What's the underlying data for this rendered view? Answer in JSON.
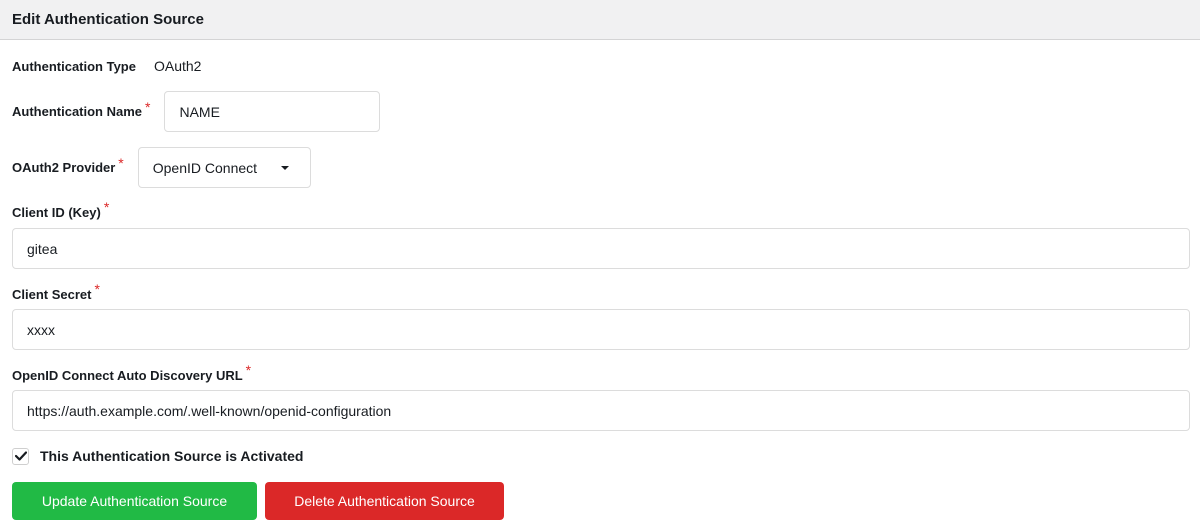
{
  "header": {
    "title": "Edit Authentication Source"
  },
  "form": {
    "auth_type": {
      "label": "Authentication Type",
      "value": "OAuth2"
    },
    "auth_name": {
      "label": "Authentication Name",
      "value": "NAME"
    },
    "provider": {
      "label": "OAuth2 Provider",
      "selected": "OpenID Connect"
    },
    "client_id": {
      "label": "Client ID (Key)",
      "value": "gitea"
    },
    "client_secret": {
      "label": "Client Secret",
      "value": "xxxx"
    },
    "discovery_url": {
      "label": "OpenID Connect Auto Discovery URL",
      "value": "https://auth.example.com/.well-known/openid-configuration"
    },
    "activated": {
      "label": "This Authentication Source is Activated",
      "checked": true
    },
    "required_marker": "*"
  },
  "actions": {
    "update_label": "Update Authentication Source",
    "delete_label": "Delete Authentication Source"
  },
  "colors": {
    "update": "#21ba45",
    "delete": "#db2828",
    "required": "#db2828"
  }
}
